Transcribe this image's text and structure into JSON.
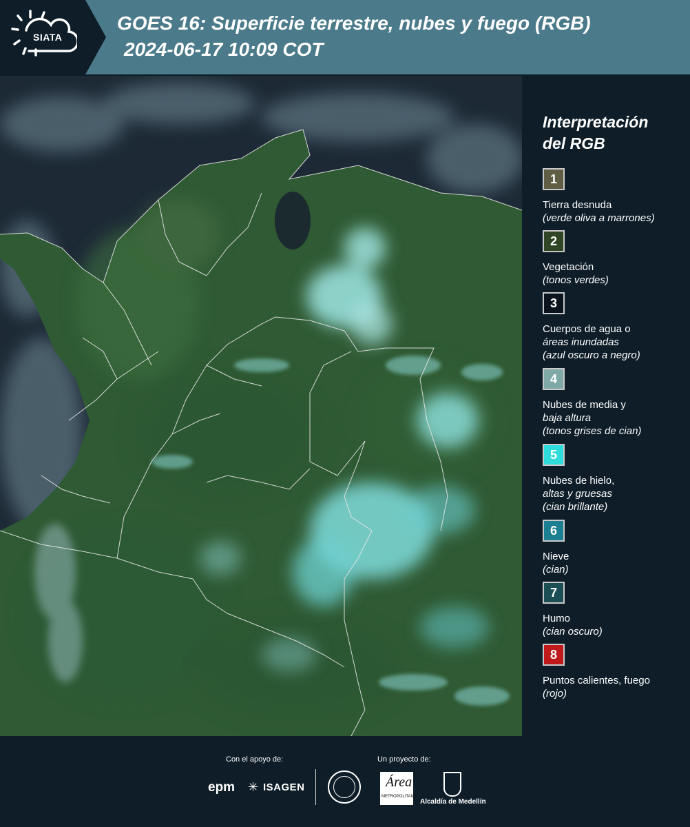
{
  "header": {
    "logo_text": "SIATA",
    "title": "GOES 16: Superficie terrestre, nubes y fuego (RGB)",
    "subtitle": "2024-06-17 10:09 COT"
  },
  "legend": {
    "title_line1": "Interpretación",
    "title_line2": "del RGB",
    "items": [
      {
        "num": "1",
        "color": "#5f5d43",
        "line1": "Tierra desnuda",
        "line2": "",
        "note": "(verde oliva a marrones)"
      },
      {
        "num": "2",
        "color": "#2f4524",
        "line1": "Vegetación",
        "line2": "",
        "note": "(tonos verdes)"
      },
      {
        "num": "3",
        "color": "#0b141c",
        "line1": "Cuerpos de agua o",
        "line2": "áreas inundadas",
        "note": "(azul oscuro a negro)"
      },
      {
        "num": "4",
        "color": "#7fa9a7",
        "line1": "Nubes de media y",
        "line2": "baja altura",
        "note": "(tonos grises de cian)"
      },
      {
        "num": "5",
        "color": "#2fdcdc",
        "line1": "Nubes de hielo,",
        "line2": "altas y gruesas",
        "note": "(cian brillante)"
      },
      {
        "num": "6",
        "color": "#1b7f91",
        "line1": "Nieve",
        "line2": "",
        "note": "(cian)"
      },
      {
        "num": "7",
        "color": "#1c4f55",
        "line1": "Humo",
        "line2": "",
        "note": "(cian oscuro)"
      },
      {
        "num": "8",
        "color": "#c0191b",
        "line1": "Puntos calientes, fuego",
        "line2": "",
        "note": "(rojo)"
      }
    ]
  },
  "footer": {
    "support_label": "Con el apoyo de:",
    "project_label": "Un proyecto de:",
    "epm": "epm",
    "isagen": "ISAGEN",
    "area_script": "Área",
    "area_text": "METROPOLITANA",
    "alcaldia": "Alcaldía de Medellín"
  }
}
